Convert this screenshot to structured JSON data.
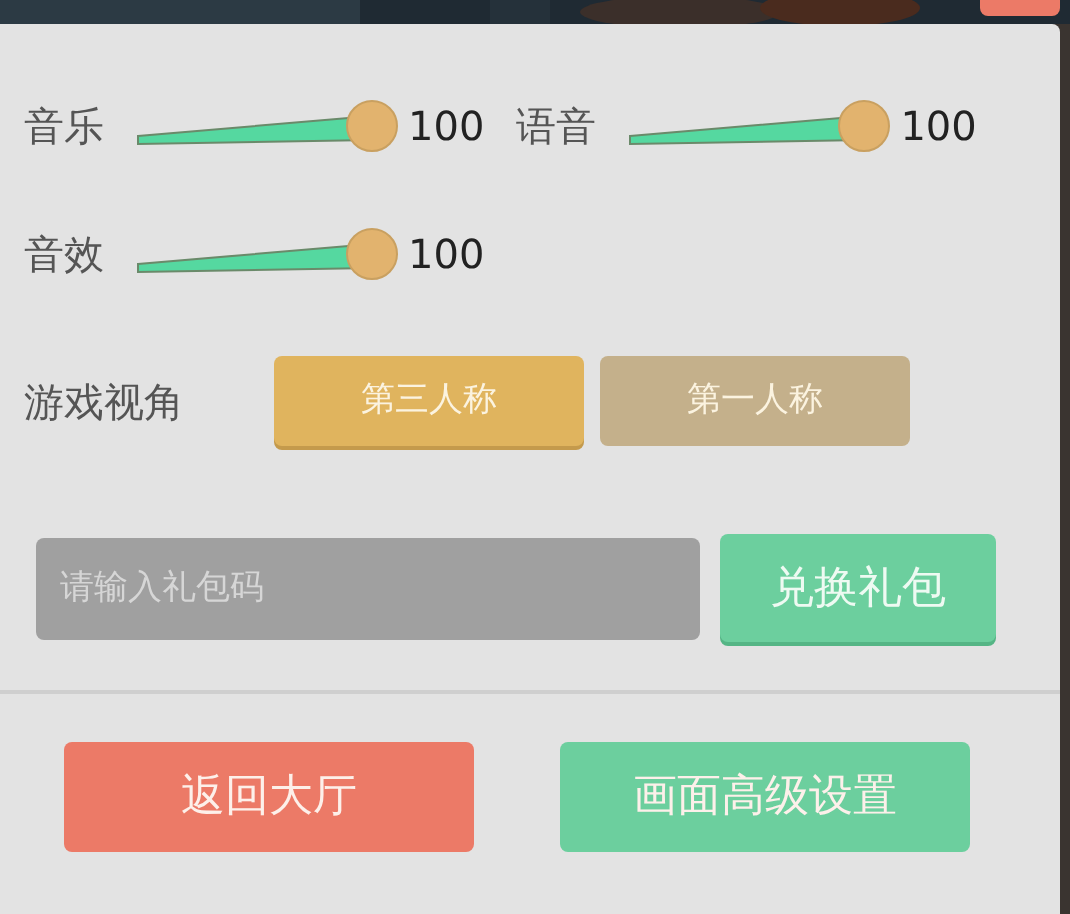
{
  "volume_sliders": [
    {
      "label": "音乐",
      "level": 1,
      "reading": "100"
    },
    {
      "label": "语音",
      "level": 1,
      "reading": "100"
    },
    {
      "label": "音效",
      "level": 1,
      "reading": "100"
    }
  ],
  "camera": {
    "label": "游戏视角",
    "options": [
      {
        "label": "第三人称",
        "selected": true
      },
      {
        "label": "第一人称",
        "selected": false
      }
    ]
  },
  "gift_code": {
    "placeholder": "请输入礼包码",
    "button": "兑换礼包"
  },
  "footer_buttons": [
    {
      "label": "返回大厅",
      "kind": "danger"
    },
    {
      "label": "画面高级设置",
      "kind": "primary"
    }
  ]
}
